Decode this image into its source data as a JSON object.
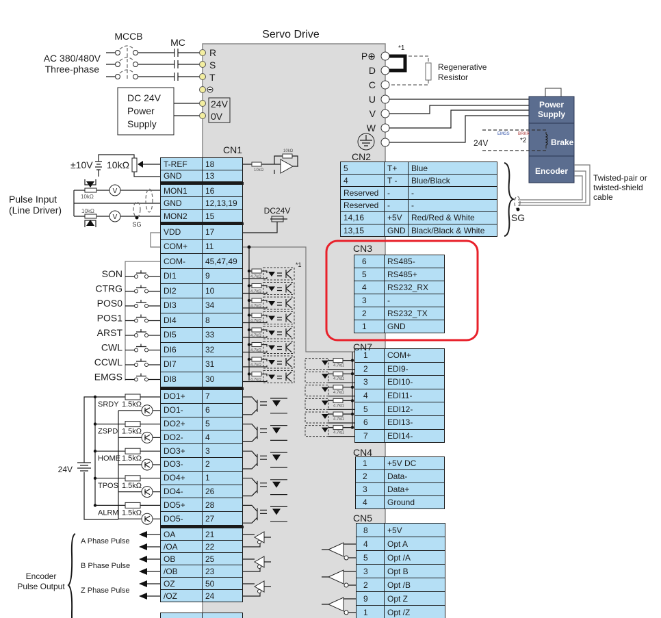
{
  "title": "Servo Drive",
  "colors": {
    "cell": "#b5dff5",
    "body": "#dcdcdc",
    "terminal": "#f3eea0",
    "motor": "#5b6d8f",
    "highlight": "#e8202a"
  },
  "power": {
    "mccb": "MCCB",
    "mc": "MC",
    "source": [
      "AC 380/480V",
      "Three-phase"
    ],
    "terminals": [
      "R",
      "S",
      "T"
    ],
    "dc_supply": [
      "DC 24V",
      "Power",
      "Supply"
    ],
    "dc_terminals": [
      "24V",
      "0V"
    ]
  },
  "right_terminals": [
    "P⊕",
    "D",
    "C",
    "U",
    "V",
    "W"
  ],
  "regen": {
    "lines": [
      "Regenerative",
      "Resistor"
    ],
    "note": "*1"
  },
  "motor": {
    "power_supply": [
      "Power",
      "Supply"
    ],
    "brake": "Brake",
    "encoder": "Encoder",
    "brake_voltage": "24V",
    "emgs": "EMGS",
    "brkr": "BRKR",
    "note": "*2",
    "cable": [
      "Twisted-pair or",
      "twisted-shield",
      "cable"
    ],
    "sg": "SG"
  },
  "analog": {
    "voltage": "±10V",
    "pot": "10kΩ",
    "opamp_r": "10kΩ"
  },
  "pulse_input": {
    "label": [
      "Pulse Input",
      "(Line Driver)"
    ],
    "pot": "10kΩ",
    "meter": "V",
    "sg": "SG"
  },
  "dc24v": "DC24V",
  "opto_r": "4.7kΩ",
  "opto_note": "*1",
  "di_names": [
    "SON",
    "CTRG",
    "POS0",
    "POS1",
    "ARST",
    "CWL",
    "CCWL",
    "EMGS"
  ],
  "do_names": [
    "SRDY",
    "ZSPD",
    "HOME",
    "TPOS",
    "ALRM"
  ],
  "do_r": "1.5kΩ",
  "do_supply": "24V",
  "encoder_out": {
    "phases": [
      "A Phase Pulse",
      "B Phase Pulse",
      "Z Phase Pulse"
    ],
    "label": [
      "Encoder",
      "Pulse Output"
    ]
  },
  "cn1": {
    "label": "CN1",
    "rows": [
      {
        "signal": "T-REF",
        "pin": "18"
      },
      {
        "signal": "GND",
        "pin": "13"
      },
      {
        "signal": "MON1",
        "pin": "16"
      },
      {
        "signal": "GND",
        "pin": "12,13,19"
      },
      {
        "signal": "MON2",
        "pin": "15"
      },
      {
        "signal": "VDD",
        "pin": "17"
      },
      {
        "signal": "COM+",
        "pin": "11"
      },
      {
        "signal": "COM-",
        "pin": "45,47,49"
      },
      {
        "signal": "DI1",
        "pin": "9"
      },
      {
        "signal": "DI2",
        "pin": "10"
      },
      {
        "signal": "DI3",
        "pin": "34"
      },
      {
        "signal": "DI4",
        "pin": "8"
      },
      {
        "signal": "DI5",
        "pin": "33"
      },
      {
        "signal": "DI6",
        "pin": "32"
      },
      {
        "signal": "DI7",
        "pin": "31"
      },
      {
        "signal": "DI8",
        "pin": "30"
      },
      {
        "signal": "DO1+",
        "pin": "7"
      },
      {
        "signal": "DO1-",
        "pin": "6"
      },
      {
        "signal": "DO2+",
        "pin": "5"
      },
      {
        "signal": "DO2-",
        "pin": "4"
      },
      {
        "signal": "DO3+",
        "pin": "3"
      },
      {
        "signal": "DO3-",
        "pin": "2"
      },
      {
        "signal": "DO4+",
        "pin": "1"
      },
      {
        "signal": "DO4-",
        "pin": "26"
      },
      {
        "signal": "DO5+",
        "pin": "28"
      },
      {
        "signal": "DO5-",
        "pin": "27"
      },
      {
        "signal": "OA",
        "pin": "21"
      },
      {
        "signal": "/OA",
        "pin": "22"
      },
      {
        "signal": "OB",
        "pin": "25"
      },
      {
        "signal": "/OB",
        "pin": "23"
      },
      {
        "signal": "OZ",
        "pin": "50"
      },
      {
        "signal": "/OZ",
        "pin": "24"
      }
    ]
  },
  "cn2": {
    "label": "CN2",
    "rows": [
      {
        "pin": "5",
        "signal": "T+",
        "color": "Blue"
      },
      {
        "pin": "4",
        "signal": "T -",
        "color": "Blue/Black"
      },
      {
        "pin": "Reserved",
        "signal": "-",
        "color": "-"
      },
      {
        "pin": "Reserved",
        "signal": "-",
        "color": "-"
      },
      {
        "pin": "14,16",
        "signal": "+5V",
        "color": "Red/Red & White"
      },
      {
        "pin": "13,15",
        "signal": "GND",
        "color": "Black/Black & White"
      }
    ]
  },
  "cn3": {
    "label": "CN3",
    "rows": [
      {
        "pin": "6",
        "signal": "RS485-"
      },
      {
        "pin": "5",
        "signal": "RS485+"
      },
      {
        "pin": "4",
        "signal": "RS232_RX"
      },
      {
        "pin": "3",
        "signal": "-"
      },
      {
        "pin": "2",
        "signal": "RS232_TX"
      },
      {
        "pin": "1",
        "signal": "GND"
      }
    ]
  },
  "cn7": {
    "label": "CN7",
    "rows": [
      {
        "pin": "1",
        "signal": "COM+"
      },
      {
        "pin": "2",
        "signal": "EDI9-"
      },
      {
        "pin": "3",
        "signal": "EDI10-"
      },
      {
        "pin": "4",
        "signal": "EDI11-"
      },
      {
        "pin": "5",
        "signal": "EDI12-"
      },
      {
        "pin": "6",
        "signal": "EDI13-"
      },
      {
        "pin": "7",
        "signal": "EDI14-"
      }
    ]
  },
  "cn4": {
    "label": "CN4",
    "rows": [
      {
        "pin": "1",
        "signal": "+5V DC"
      },
      {
        "pin": "2",
        "signal": "Data-"
      },
      {
        "pin": "3",
        "signal": "Data+"
      },
      {
        "pin": "4",
        "signal": "Ground"
      }
    ]
  },
  "cn5": {
    "label": "CN5",
    "rows": [
      {
        "pin": "8",
        "signal": "+5V"
      },
      {
        "pin": "4",
        "signal": "Opt A"
      },
      {
        "pin": "5",
        "signal": "Opt /A"
      },
      {
        "pin": "3",
        "signal": "Opt B"
      },
      {
        "pin": "2",
        "signal": "Opt /B"
      },
      {
        "pin": "9",
        "signal": "Opt Z"
      },
      {
        "pin": "1",
        "signal": "Opt /Z"
      }
    ]
  }
}
